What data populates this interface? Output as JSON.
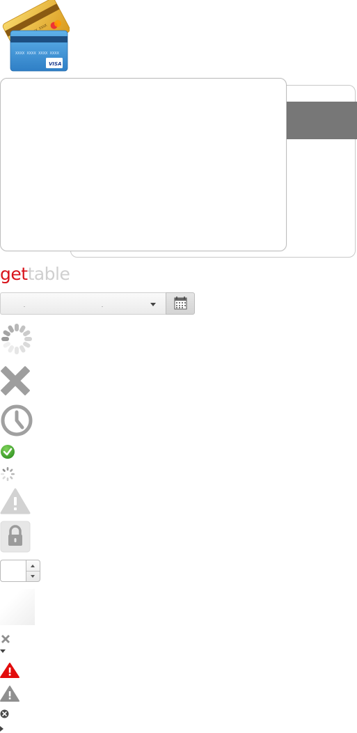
{
  "icons": {
    "cards": "credit-cards-icon",
    "spinner_large": "loading-spinner-icon",
    "close_large": "close-icon",
    "clock": "clock-icon",
    "check": "check-circle-icon",
    "spinner_small": "loading-spinner-small-icon",
    "warning_large": "warning-icon",
    "lock": "lock-icon",
    "close_small": "close-small-icon",
    "caret_down": "caret-down-icon",
    "warning_red": "warning-red-icon",
    "warning_gray": "warning-gray-icon",
    "close_circle": "close-circle-icon",
    "caret_right": "caret-right-icon",
    "calendar": "calendar-icon"
  },
  "logo": {
    "part1": "get",
    "part2": "table"
  },
  "card_visa": {
    "number": "XXXX XXXX XXXX XXXX",
    "brand": "VISA"
  },
  "card_mc": {
    "number": "XXXX XXXX",
    "brand": "MasterCard"
  },
  "colors": {
    "brand_red": "#d8131b",
    "logo_gray": "#cfcfcf",
    "strip_gray": "#777777",
    "success_green": "#3aa82e",
    "icon_gray": "#9a9a9a"
  }
}
